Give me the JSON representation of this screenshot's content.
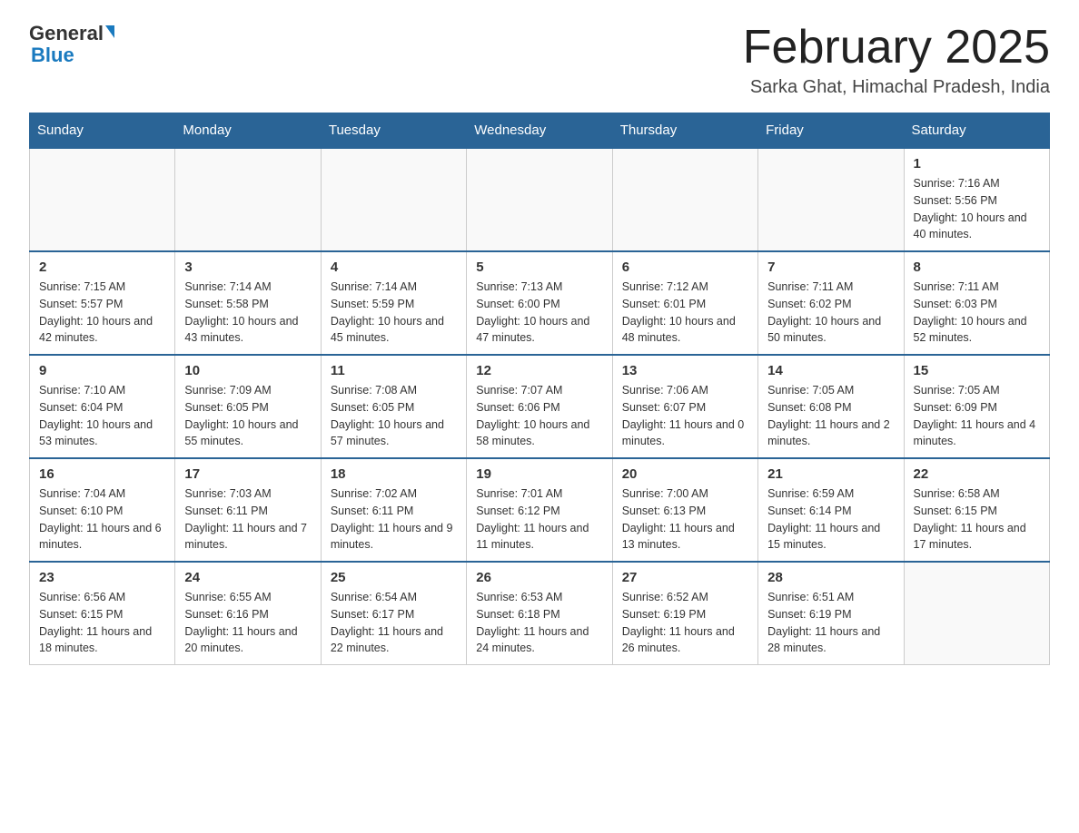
{
  "header": {
    "logo_general": "General",
    "logo_blue": "Blue",
    "month_title": "February 2025",
    "location": "Sarka Ghat, Himachal Pradesh, India"
  },
  "days_of_week": [
    "Sunday",
    "Monday",
    "Tuesday",
    "Wednesday",
    "Thursday",
    "Friday",
    "Saturday"
  ],
  "weeks": [
    [
      {
        "day": "",
        "info": ""
      },
      {
        "day": "",
        "info": ""
      },
      {
        "day": "",
        "info": ""
      },
      {
        "day": "",
        "info": ""
      },
      {
        "day": "",
        "info": ""
      },
      {
        "day": "",
        "info": ""
      },
      {
        "day": "1",
        "info": "Sunrise: 7:16 AM\nSunset: 5:56 PM\nDaylight: 10 hours and 40 minutes."
      }
    ],
    [
      {
        "day": "2",
        "info": "Sunrise: 7:15 AM\nSunset: 5:57 PM\nDaylight: 10 hours and 42 minutes."
      },
      {
        "day": "3",
        "info": "Sunrise: 7:14 AM\nSunset: 5:58 PM\nDaylight: 10 hours and 43 minutes."
      },
      {
        "day": "4",
        "info": "Sunrise: 7:14 AM\nSunset: 5:59 PM\nDaylight: 10 hours and 45 minutes."
      },
      {
        "day": "5",
        "info": "Sunrise: 7:13 AM\nSunset: 6:00 PM\nDaylight: 10 hours and 47 minutes."
      },
      {
        "day": "6",
        "info": "Sunrise: 7:12 AM\nSunset: 6:01 PM\nDaylight: 10 hours and 48 minutes."
      },
      {
        "day": "7",
        "info": "Sunrise: 7:11 AM\nSunset: 6:02 PM\nDaylight: 10 hours and 50 minutes."
      },
      {
        "day": "8",
        "info": "Sunrise: 7:11 AM\nSunset: 6:03 PM\nDaylight: 10 hours and 52 minutes."
      }
    ],
    [
      {
        "day": "9",
        "info": "Sunrise: 7:10 AM\nSunset: 6:04 PM\nDaylight: 10 hours and 53 minutes."
      },
      {
        "day": "10",
        "info": "Sunrise: 7:09 AM\nSunset: 6:05 PM\nDaylight: 10 hours and 55 minutes."
      },
      {
        "day": "11",
        "info": "Sunrise: 7:08 AM\nSunset: 6:05 PM\nDaylight: 10 hours and 57 minutes."
      },
      {
        "day": "12",
        "info": "Sunrise: 7:07 AM\nSunset: 6:06 PM\nDaylight: 10 hours and 58 minutes."
      },
      {
        "day": "13",
        "info": "Sunrise: 7:06 AM\nSunset: 6:07 PM\nDaylight: 11 hours and 0 minutes."
      },
      {
        "day": "14",
        "info": "Sunrise: 7:05 AM\nSunset: 6:08 PM\nDaylight: 11 hours and 2 minutes."
      },
      {
        "day": "15",
        "info": "Sunrise: 7:05 AM\nSunset: 6:09 PM\nDaylight: 11 hours and 4 minutes."
      }
    ],
    [
      {
        "day": "16",
        "info": "Sunrise: 7:04 AM\nSunset: 6:10 PM\nDaylight: 11 hours and 6 minutes."
      },
      {
        "day": "17",
        "info": "Sunrise: 7:03 AM\nSunset: 6:11 PM\nDaylight: 11 hours and 7 minutes."
      },
      {
        "day": "18",
        "info": "Sunrise: 7:02 AM\nSunset: 6:11 PM\nDaylight: 11 hours and 9 minutes."
      },
      {
        "day": "19",
        "info": "Sunrise: 7:01 AM\nSunset: 6:12 PM\nDaylight: 11 hours and 11 minutes."
      },
      {
        "day": "20",
        "info": "Sunrise: 7:00 AM\nSunset: 6:13 PM\nDaylight: 11 hours and 13 minutes."
      },
      {
        "day": "21",
        "info": "Sunrise: 6:59 AM\nSunset: 6:14 PM\nDaylight: 11 hours and 15 minutes."
      },
      {
        "day": "22",
        "info": "Sunrise: 6:58 AM\nSunset: 6:15 PM\nDaylight: 11 hours and 17 minutes."
      }
    ],
    [
      {
        "day": "23",
        "info": "Sunrise: 6:56 AM\nSunset: 6:15 PM\nDaylight: 11 hours and 18 minutes."
      },
      {
        "day": "24",
        "info": "Sunrise: 6:55 AM\nSunset: 6:16 PM\nDaylight: 11 hours and 20 minutes."
      },
      {
        "day": "25",
        "info": "Sunrise: 6:54 AM\nSunset: 6:17 PM\nDaylight: 11 hours and 22 minutes."
      },
      {
        "day": "26",
        "info": "Sunrise: 6:53 AM\nSunset: 6:18 PM\nDaylight: 11 hours and 24 minutes."
      },
      {
        "day": "27",
        "info": "Sunrise: 6:52 AM\nSunset: 6:19 PM\nDaylight: 11 hours and 26 minutes."
      },
      {
        "day": "28",
        "info": "Sunrise: 6:51 AM\nSunset: 6:19 PM\nDaylight: 11 hours and 28 minutes."
      },
      {
        "day": "",
        "info": ""
      }
    ]
  ]
}
